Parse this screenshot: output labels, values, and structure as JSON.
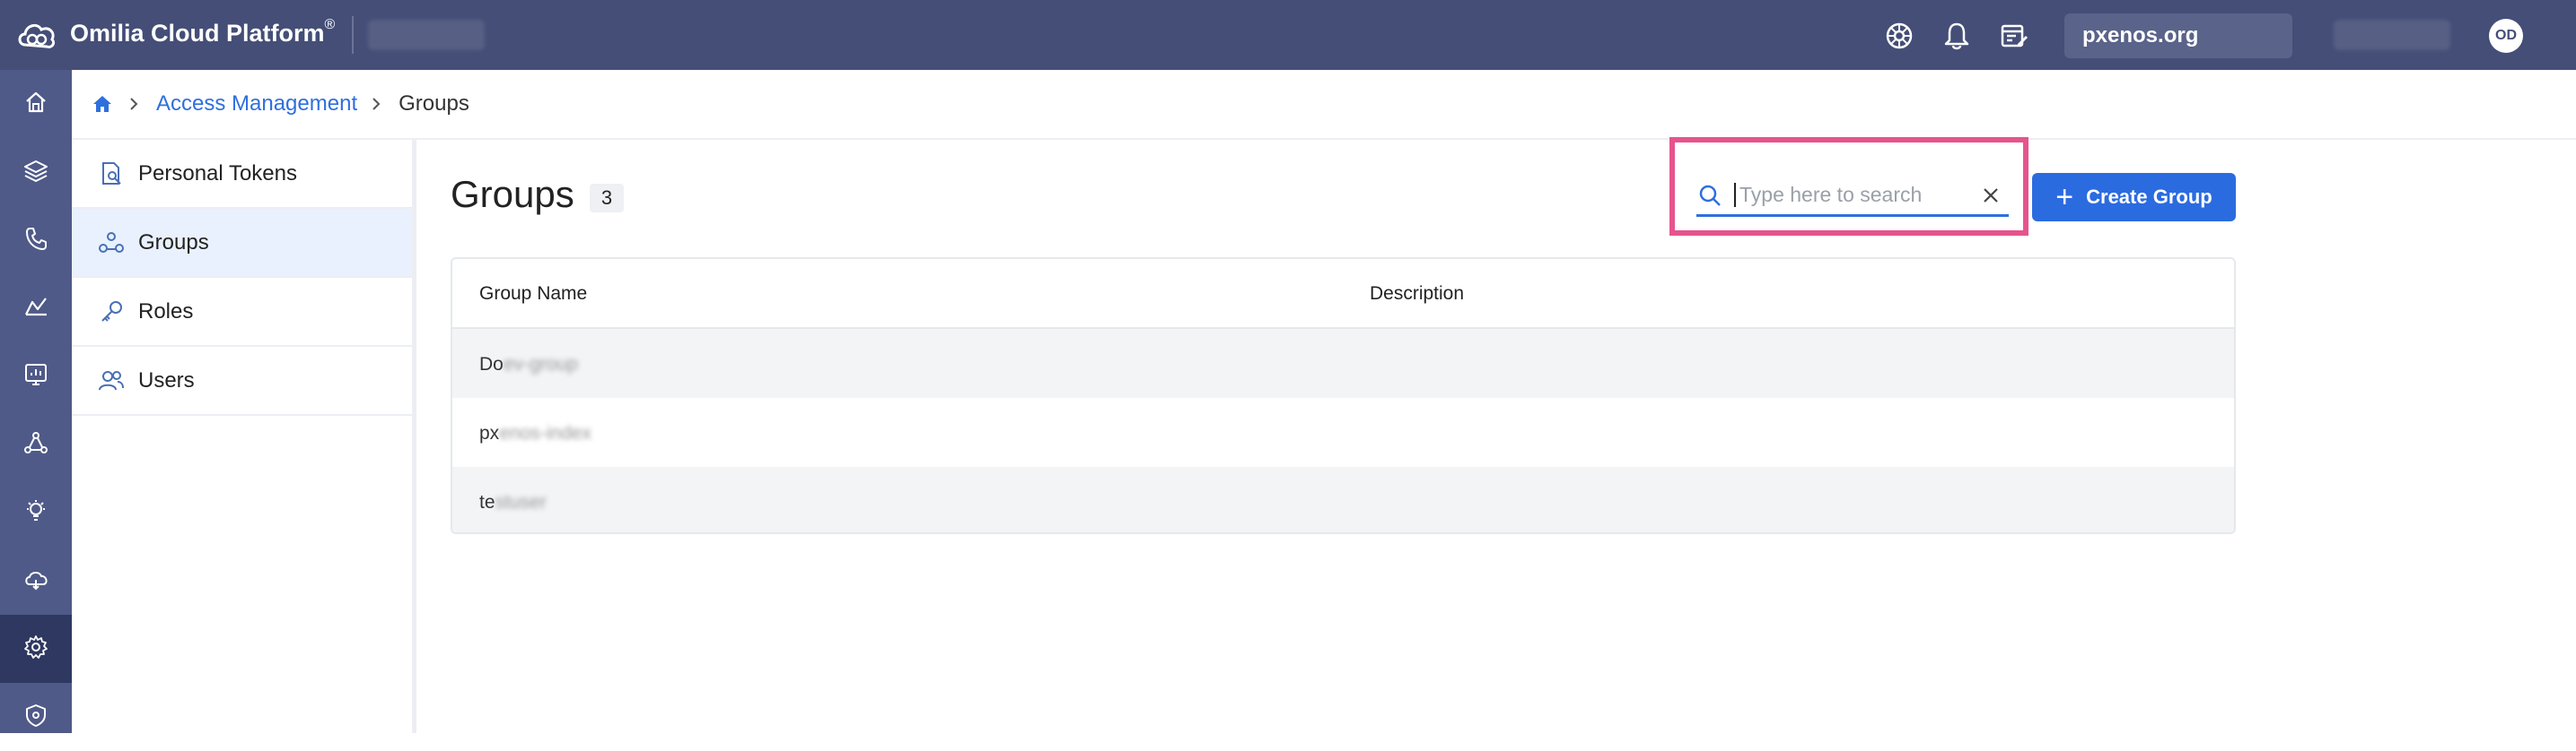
{
  "app": {
    "title": "Omilia Cloud Platform",
    "trademark": "®"
  },
  "topbar": {
    "org": "pxenos.org",
    "avatar_initials": "OD",
    "icons": [
      "help-wheel-icon",
      "bell-icon",
      "release-notes-icon"
    ]
  },
  "rail": {
    "items": [
      "home-icon",
      "layers-icon",
      "phone-icon",
      "analytics-icon",
      "monitor-icon",
      "network-icon",
      "bulb-icon",
      "cloud-icon",
      "settings-icon",
      "shield-icon"
    ],
    "active": "settings-icon"
  },
  "breadcrumb": {
    "parent": "Access Management",
    "current": "Groups"
  },
  "subnav": {
    "items": [
      {
        "label": "Personal Tokens",
        "icon": "token-icon"
      },
      {
        "label": "Groups",
        "icon": "groups-icon"
      },
      {
        "label": "Roles",
        "icon": "key-icon"
      },
      {
        "label": "Users",
        "icon": "users-icon"
      }
    ],
    "active": "Groups"
  },
  "main": {
    "title": "Groups",
    "count": "3",
    "search": {
      "placeholder": "Type here to search"
    },
    "create_button": "Create Group"
  },
  "table": {
    "columns": [
      "Group Name",
      "Description"
    ],
    "rows": [
      {
        "prefix": "Do",
        "hidden": "ev-group",
        "description": ""
      },
      {
        "prefix": "px",
        "hidden": "enos-index",
        "description": ""
      },
      {
        "prefix": "te",
        "hidden": "stuser",
        "description": ""
      }
    ]
  },
  "colors": {
    "topbar": "#444e77",
    "rail": "#4f5a88",
    "accent": "#2b6be0",
    "highlight": "#e6548d"
  }
}
